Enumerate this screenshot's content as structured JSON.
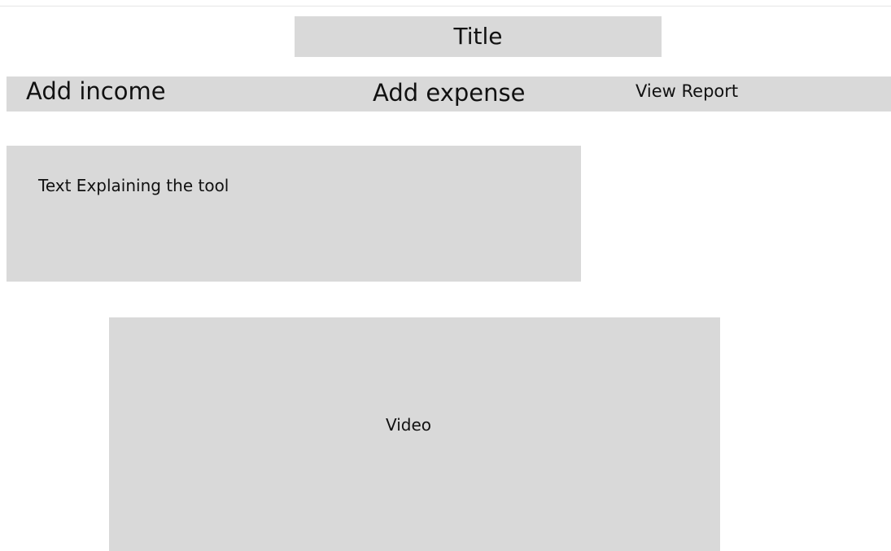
{
  "header": {
    "title": "Title"
  },
  "nav": {
    "add_income": "Add income",
    "add_expense": "Add expense",
    "view_report": "View Report"
  },
  "explanation": {
    "text": "Text Explaining the tool"
  },
  "video": {
    "label": "Video"
  }
}
